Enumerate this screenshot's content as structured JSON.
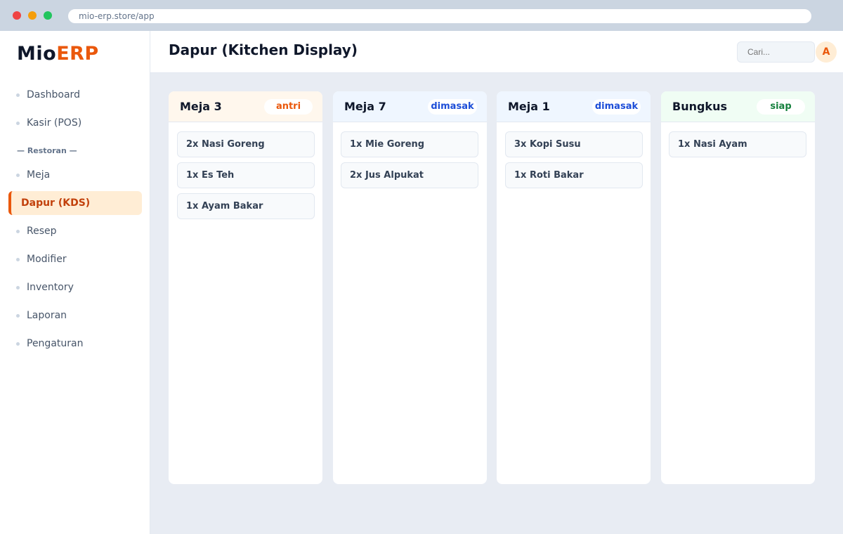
{
  "browser": {
    "url": "mio-erp.store/app"
  },
  "brand": {
    "part1": "Mio",
    "part2": "ERP",
    "accent_color": "#ea580c"
  },
  "sidebar": {
    "items": [
      {
        "label": "Dashboard"
      },
      {
        "label": "Kasir (POS)"
      },
      {
        "label": "Meja"
      },
      {
        "label": "Dapur (KDS)",
        "active": true
      },
      {
        "label": "Resep"
      },
      {
        "label": "Modifier"
      },
      {
        "label": "Inventory"
      },
      {
        "label": "Laporan"
      },
      {
        "label": "Pengaturan"
      }
    ],
    "section_label": "— Restoran —"
  },
  "header": {
    "title": "Dapur (Kitchen Display)",
    "search_placeholder": "Cari...",
    "avatar_initial": "A"
  },
  "columns": [
    {
      "name": "Meja 3",
      "status": "antri",
      "status_color": "#ea580c",
      "header_bg": "#fff7ed",
      "items": [
        "2x Nasi Goreng",
        "1x Es Teh",
        "1x Ayam Bakar"
      ]
    },
    {
      "name": "Meja 7",
      "status": "dimasak",
      "status_color": "#1d4ed8",
      "header_bg": "#eff6ff",
      "items": [
        "1x Mie Goreng",
        "2x Jus Alpukat"
      ]
    },
    {
      "name": "Meja 1",
      "status": "dimasak",
      "status_color": "#1d4ed8",
      "header_bg": "#eff6ff",
      "items": [
        "3x Kopi Susu",
        "1x Roti Bakar"
      ]
    },
    {
      "name": "Bungkus",
      "status": "siap",
      "status_color": "#15803d",
      "header_bg": "#f0fdf4",
      "items": [
        "1x Nasi Ayam"
      ]
    }
  ]
}
